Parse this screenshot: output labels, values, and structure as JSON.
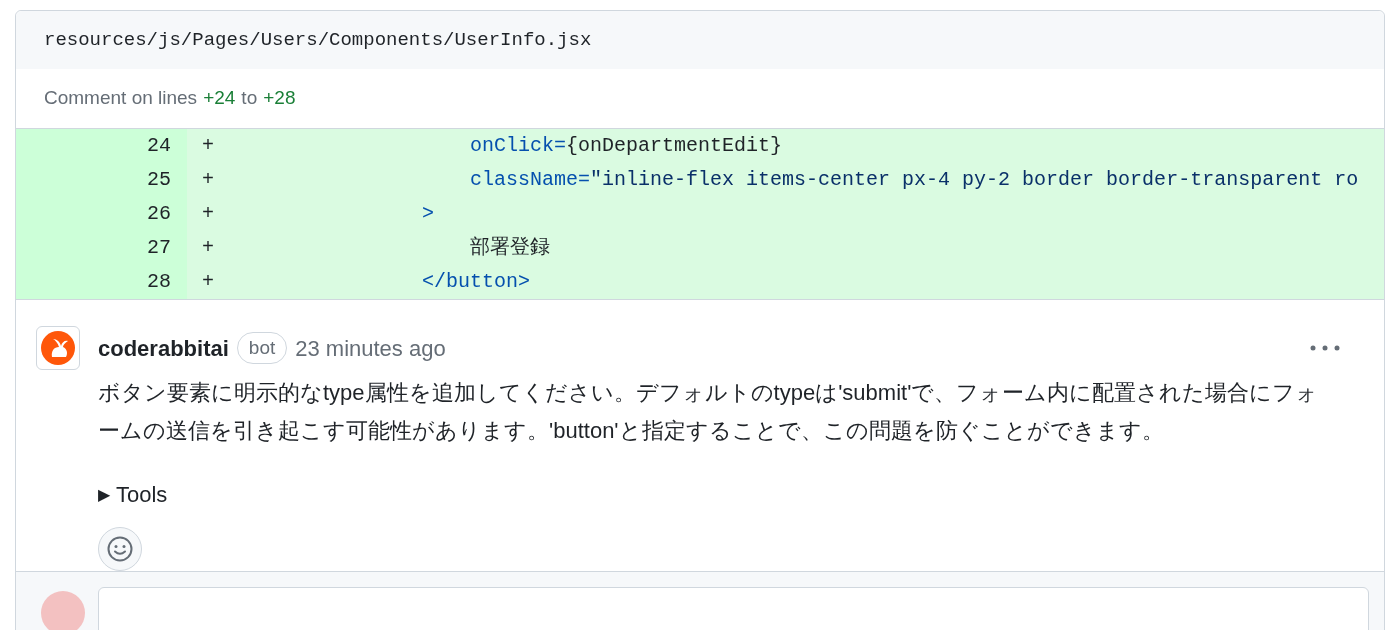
{
  "file_header": {
    "path": "resources/js/Pages/Users/Components/UserInfo.jsx"
  },
  "comment_range": {
    "prefix": "Comment on lines",
    "start": "+24",
    "middle": "to",
    "end": "+28"
  },
  "diff_lines": [
    {
      "number": "24",
      "sign": "+",
      "kind": "attribute",
      "tokens": [
        {
          "kind": "attr",
          "text": "onClick="
        },
        {
          "kind": "plain",
          "text": "{onDepartmentEdit}"
        }
      ]
    },
    {
      "number": "25",
      "sign": "+",
      "kind": "attribute",
      "tokens": [
        {
          "kind": "attr",
          "text": "className="
        },
        {
          "kind": "string",
          "text": "\"inline-flex items-center px-4 py-2 border border-transparent ro"
        }
      ]
    },
    {
      "number": "26",
      "sign": "+",
      "kind": "element",
      "tokens": [
        {
          "kind": "tag",
          "text": ">"
        }
      ]
    },
    {
      "number": "27",
      "sign": "+",
      "kind": "attribute",
      "tokens": [
        {
          "kind": "plain",
          "text": "部署登録"
        }
      ]
    },
    {
      "number": "28",
      "sign": "+",
      "kind": "element",
      "tokens": [
        {
          "kind": "tag",
          "text": "</button>"
        }
      ]
    }
  ],
  "comment": {
    "author": "coderabbitai",
    "badge": "bot",
    "time": "23 minutes ago",
    "body": "ボタン要素に明示的なtype属性を追加してください。デフォルトのtypeは'submit'で、フォーム内に配置された場合にフォームの送信を引き起こす可能性があります。'button'と指定することで、この問題を防ぐことができます。",
    "details": {
      "marker": "▶",
      "label": "Tools",
      "expanded": false
    }
  }
}
